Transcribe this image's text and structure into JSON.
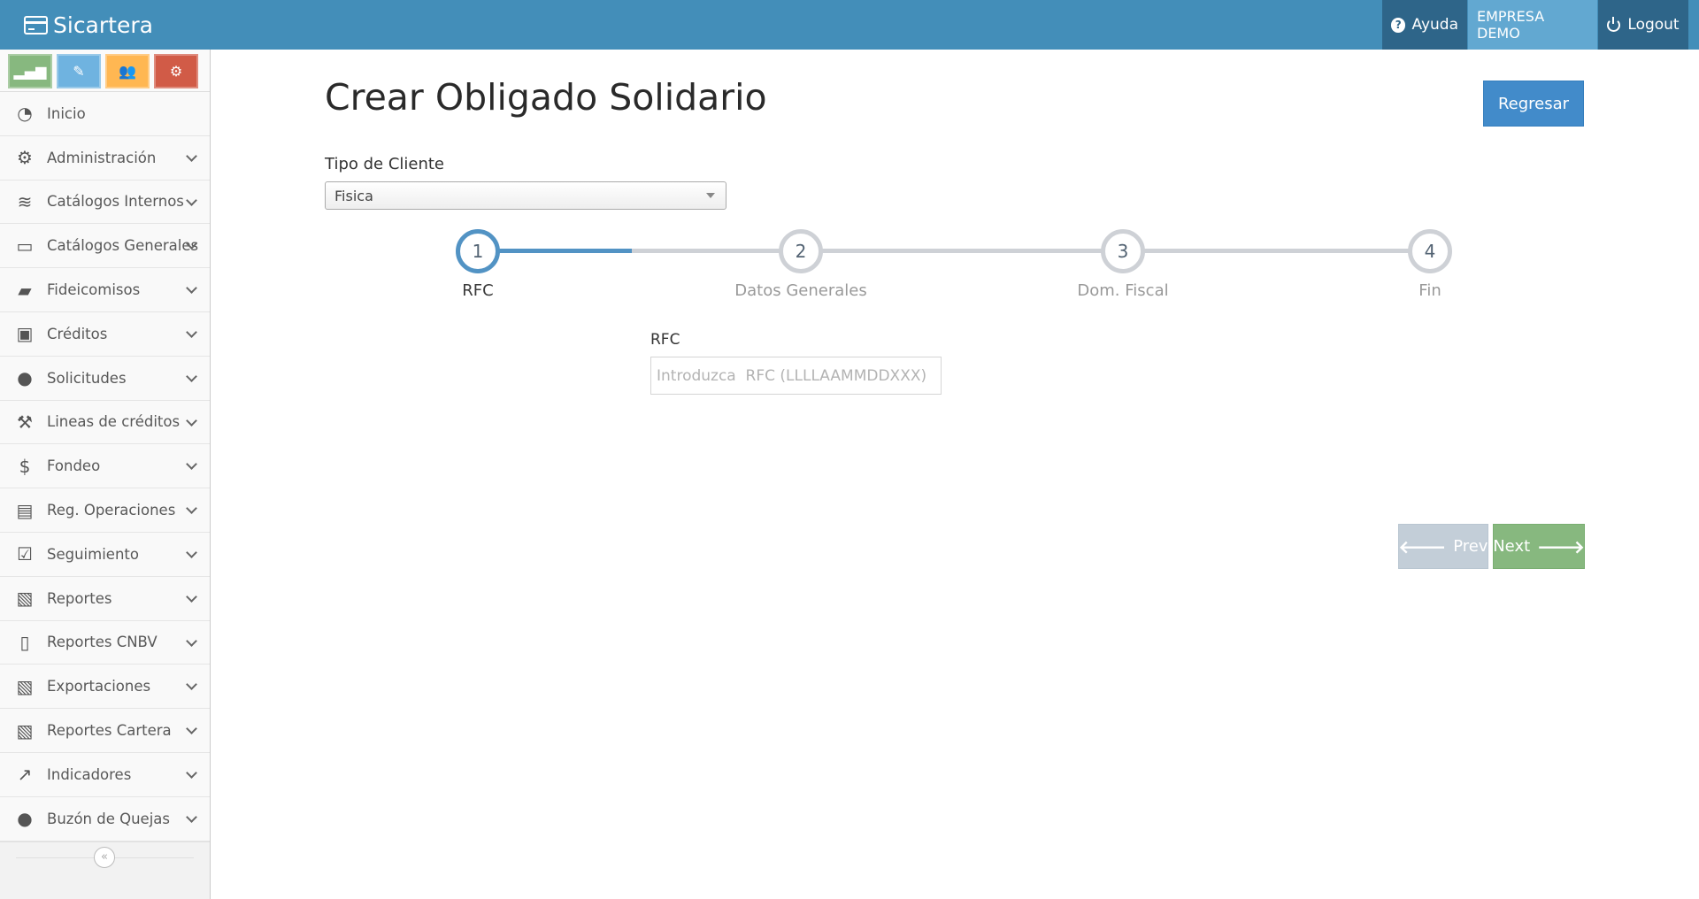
{
  "app": {
    "brand": "Sicartera",
    "nav": {
      "help_label": "Ayuda",
      "company_label": "EMPRESA DEMO",
      "logout_label": "Logout"
    }
  },
  "sidebar": {
    "shortcuts": [
      {
        "name": "stats-icon",
        "symbol": "▂▄▆",
        "color": "#87b87f"
      },
      {
        "name": "pencil-icon",
        "symbol": "✎",
        "color": "#6fb3e0"
      },
      {
        "name": "users-icon",
        "symbol": "👥",
        "color": "#ffb752"
      },
      {
        "name": "cogs-icon",
        "symbol": "⚙",
        "color": "#d15b47"
      }
    ],
    "items": [
      {
        "label": "Inicio",
        "icon": "dashboard-icon",
        "symbol": "◔",
        "has_submenu": false
      },
      {
        "label": "Administración",
        "icon": "cogs-icon",
        "symbol": "⚙",
        "has_submenu": true
      },
      {
        "label": "Catálogos Internos",
        "icon": "database-icon",
        "symbol": "≋",
        "has_submenu": true
      },
      {
        "label": "Catálogos Generales",
        "icon": "desktop-icon",
        "symbol": "▭",
        "has_submenu": true
      },
      {
        "label": "Fideicomisos",
        "icon": "folder-open-icon",
        "symbol": "▰",
        "has_submenu": true
      },
      {
        "label": "Créditos",
        "icon": "briefcase-icon",
        "symbol": "▣",
        "has_submenu": true
      },
      {
        "label": "Solicitudes",
        "icon": "user-icon",
        "symbol": "●",
        "has_submenu": true
      },
      {
        "label": "Lineas de créditos",
        "icon": "gavel-icon",
        "symbol": "⚒",
        "has_submenu": true
      },
      {
        "label": "Fondeo",
        "icon": "dollar-icon",
        "symbol": "$",
        "has_submenu": true
      },
      {
        "label": "Reg. Operaciones",
        "icon": "file-text-icon",
        "symbol": "▤",
        "has_submenu": true
      },
      {
        "label": "Seguimiento",
        "icon": "check-square-icon",
        "symbol": "☑",
        "has_submenu": true
      },
      {
        "label": "Reportes",
        "icon": "file-excel-icon",
        "symbol": "▧",
        "has_submenu": true
      },
      {
        "label": "Reportes CNBV",
        "icon": "file-icon",
        "symbol": "▯",
        "has_submenu": true
      },
      {
        "label": "Exportaciones",
        "icon": "file-excel-icon",
        "symbol": "▧",
        "has_submenu": true
      },
      {
        "label": "Reportes Cartera",
        "icon": "file-excel-icon",
        "symbol": "▧",
        "has_submenu": true
      },
      {
        "label": "Indicadores",
        "icon": "line-chart-icon",
        "symbol": "↗",
        "has_submenu": true
      },
      {
        "label": "Buzón de Quejas",
        "icon": "comment-icon",
        "symbol": "●",
        "has_submenu": true
      }
    ],
    "collapse_symbol": "«"
  },
  "main": {
    "title": "Crear Obligado Solidario",
    "back_button": "Regresar",
    "client_type_label": "Tipo de Cliente",
    "client_type_value": "Fisica",
    "wizard": {
      "active_step": 1,
      "steps": [
        {
          "number": "1",
          "title": "RFC"
        },
        {
          "number": "2",
          "title": "Datos Generales"
        },
        {
          "number": "3",
          "title": "Dom. Fiscal"
        },
        {
          "number": "4",
          "title": "Fin"
        }
      ]
    },
    "rfc": {
      "label": "RFC",
      "value": "",
      "placeholder": "Introduzca  RFC (LLLLAAMMDDXXX)"
    },
    "prev_button": "Prev",
    "next_button": "Next"
  },
  "colors": {
    "navbar": "#438eb9",
    "primary": "#428bca",
    "success": "#87b87f",
    "step_active": "#5293c4"
  }
}
